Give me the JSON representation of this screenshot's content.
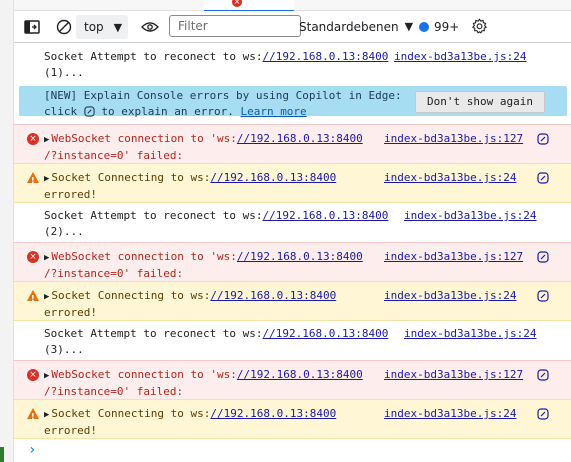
{
  "toolbar": {
    "context": "top",
    "filter_placeholder": "Filter",
    "levels": "Standardebenen",
    "issues_count": "99+"
  },
  "banner": {
    "line1": "[NEW] Explain Console errors by using Copilot in Edge:",
    "line2_pre": "click",
    "line2_mid": " to explain an error. ",
    "link": "Learn more",
    "button": "Don't show again"
  },
  "messages": [
    {
      "type": "log",
      "l1": "Socket Attempt to reconect to ws:",
      "url": "//192.168.0.13:8400",
      "l2": "(1)...",
      "src": "index-bd3a13be.js:24"
    },
    {
      "type": "error",
      "l1a": "WebSocket connection to 'ws:",
      "url": "//192.168.0.13:8400",
      "l2": "/?instance=0' failed:",
      "src": "index-bd3a13be.js:127"
    },
    {
      "type": "warn",
      "l1": "Socket Connecting to ws:",
      "url": "//192.168.0.13:8400",
      "l2": "errored!",
      "src": "index-bd3a13be.js:24"
    },
    {
      "type": "log",
      "l1": "Socket Attempt to reconect to ws:",
      "url": "//192.168.0.13:8400",
      "l2": "(2)...",
      "src": "index-bd3a13be.js:24"
    },
    {
      "type": "error",
      "l1a": "WebSocket connection to 'ws:",
      "url": "//192.168.0.13:8400",
      "l2": "/?instance=0' failed:",
      "src": "index-bd3a13be.js:127"
    },
    {
      "type": "warn",
      "l1": "Socket Connecting to ws:",
      "url": "//192.168.0.13:8400",
      "l2": "errored!",
      "src": "index-bd3a13be.js:24"
    },
    {
      "type": "log",
      "l1": "Socket Attempt to reconect to ws:",
      "url": "//192.168.0.13:8400",
      "l2": "(3)...",
      "src": "index-bd3a13be.js:24"
    },
    {
      "type": "error",
      "l1a": "WebSocket connection to 'ws:",
      "url": "//192.168.0.13:8400",
      "l2": "/?instance=0' failed:",
      "src": "index-bd3a13be.js:127"
    },
    {
      "type": "warn",
      "l1": "Socket Connecting to ws:",
      "url": "//192.168.0.13:8400",
      "l2": "errored!",
      "src": "index-bd3a13be.js:24"
    }
  ],
  "prompt": "›",
  "icons": {
    "error": "error-circle-icon",
    "warn": "warning-triangle-icon",
    "copilot": "copilot-icon",
    "settings": "gear-icon"
  }
}
